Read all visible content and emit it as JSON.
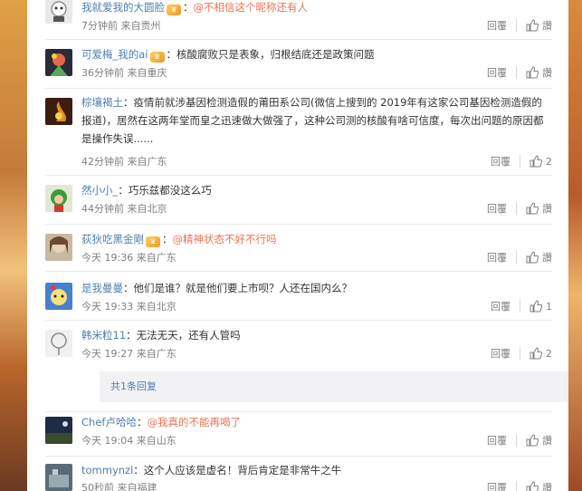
{
  "comments": [
    {
      "user": "我就爱我的大圆脸",
      "badge": true,
      "text": "@不相信这个昵称还有人",
      "text_prefix": "：",
      "time": "7分钟前 来自贵州",
      "reply": "回覆",
      "like_label": "讚",
      "like_count": ""
    },
    {
      "user": "可爱梅_我的ai",
      "badge": true,
      "text": "核酸腐败只是表象，归根结底还是政策问题",
      "text_prefix": "：",
      "time": "36分钟前 来自重庆",
      "reply": "回覆",
      "like_label": "讚",
      "like_count": ""
    },
    {
      "user": "棕壤褐土",
      "badge": false,
      "text": "疫情前就涉基因检测造假的莆田系公司(微信上搜到的 2019年有这家公司基因检测造假的报道)，居然在这两年堂而皇之迅速做大做强了，这种公司测的核酸有啥可信度，每次出问题的原因都是操作失误......",
      "text_prefix": "：",
      "time": "42分钟前 来自广东",
      "reply": "回覆",
      "like_label": "",
      "like_count": "2"
    },
    {
      "user": "然小小_",
      "badge": false,
      "text": "巧乐兹都没这么巧",
      "text_prefix": "：",
      "time": "44分钟前 来自北京",
      "reply": "回覆",
      "like_label": "讚",
      "like_count": ""
    },
    {
      "user": "荻狄吃黑金剛",
      "badge": true,
      "text": "@精神状态不好不行吗",
      "text_prefix": "：",
      "time": "今天 19:36 来自广东",
      "reply": "回覆",
      "like_label": "讚",
      "like_count": ""
    },
    {
      "user": "是我曼曼",
      "badge": false,
      "text": "他们是谁？就是他们要上市呗？人还在国内么？",
      "text_prefix": "：",
      "time": "今天 19:33 来自北京",
      "reply": "回覆",
      "like_label": "",
      "like_count": "1"
    },
    {
      "user": "韩米粒11",
      "badge": false,
      "text": "无法无天，还有人管吗",
      "text_prefix": "：",
      "time": "今天 19:27 来自广东",
      "reply": "回覆",
      "like_label": "",
      "like_count": "2"
    },
    {
      "user": "Chef卢哈哈",
      "badge": false,
      "text": "@我真的不能再喝了",
      "text_prefix": "：",
      "time": "今天 19:04 来自山东",
      "reply": "回覆",
      "like_label": "讚",
      "like_count": ""
    },
    {
      "user": "tommynzl",
      "badge": false,
      "text": "这个人应该是虚名！背后肯定是非常牛之牛",
      "text_prefix": "：",
      "time": "50秒前 来自福建",
      "reply": "回覆",
      "like_label": "讚",
      "like_count": ""
    }
  ],
  "sub_reply": "共1条回复",
  "colors": {
    "username": "#507daf",
    "mention": "#eb7350",
    "meta": "#808080"
  }
}
